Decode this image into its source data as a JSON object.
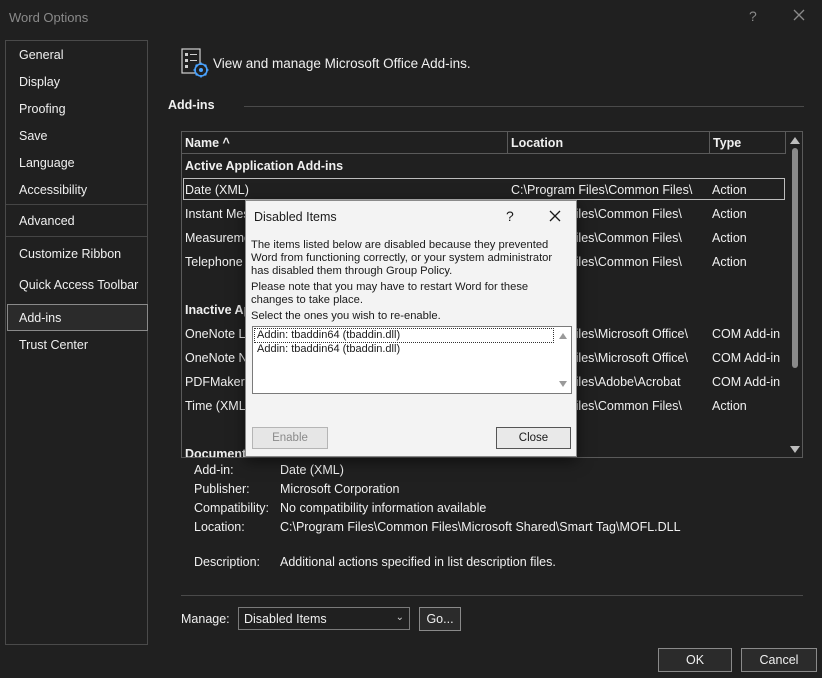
{
  "window": {
    "title": "Word Options",
    "help_glyph": "?"
  },
  "sidebar": {
    "items": [
      {
        "label": "General"
      },
      {
        "label": "Display"
      },
      {
        "label": "Proofing"
      },
      {
        "label": "Save"
      },
      {
        "label": "Language"
      },
      {
        "label": "Accessibility"
      },
      {
        "label": "Advanced"
      },
      {
        "label": "Customize Ribbon"
      },
      {
        "label": "Quick Access Toolbar"
      },
      {
        "label": "Add-ins"
      },
      {
        "label": "Trust Center"
      }
    ],
    "selected": "Add-ins"
  },
  "main": {
    "header": "View and manage Microsoft Office Add-ins.",
    "section_title": "Add-ins",
    "columns": {
      "name": "Name ^",
      "location": "Location",
      "type": "Type"
    },
    "groups": {
      "active": "Active Application Add-ins",
      "inactive": "Inactive Ap",
      "document": "Document"
    },
    "active_rows": [
      {
        "name": "Date (XML)",
        "location": "C:\\Program Files\\Common Files\\",
        "type": "Action"
      },
      {
        "name": "Instant Mes",
        "location": "Files\\Common Files\\",
        "type": "Action"
      },
      {
        "name": "Measureme",
        "location": "Files\\Common Files\\",
        "type": "Action"
      },
      {
        "name": "Telephone",
        "location": "Files\\Common Files\\",
        "type": "Action"
      }
    ],
    "inactive_rows": [
      {
        "name": "OneNote Li",
        "location": "Files\\Microsoft Office\\",
        "type": "COM Add-in"
      },
      {
        "name": "OneNote N",
        "location": "Files\\Microsoft Office\\",
        "type": "COM Add-in"
      },
      {
        "name": "PDFMaker.C",
        "location": "Files\\Adobe\\Acrobat",
        "type": "COM Add-in"
      },
      {
        "name": "Time (XML)",
        "location": "Files\\Common Files\\",
        "type": "Action"
      }
    ],
    "details": {
      "addin_label": "Add-in:",
      "addin": "Date (XML)",
      "publisher_label": "Publisher:",
      "publisher": "Microsoft Corporation",
      "compat_label": "Compatibility:",
      "compat": "No compatibility information available",
      "location_label": "Location:",
      "location": "C:\\Program Files\\Common Files\\Microsoft Shared\\Smart Tag\\MOFL.DLL",
      "description_label": "Description:",
      "description": "Additional actions specified in list description files."
    },
    "manage": {
      "label": "Manage:",
      "selected": "Disabled Items",
      "go_label": "Go..."
    }
  },
  "footer": {
    "ok_label": "OK",
    "cancel_label": "Cancel"
  },
  "modal": {
    "title": "Disabled Items",
    "help_glyph": "?",
    "text1": "The items listed below are disabled because they prevented Word from functioning correctly, or your system administrator has disabled them through Group Policy.",
    "text2": "Please note that you may have to restart Word for these changes to take place.",
    "text3": "Select the ones you wish to re-enable.",
    "items": [
      {
        "label": "Addin: tbaddin64 (tbaddin.dll)"
      },
      {
        "label": "Addin: tbaddin64 (tbaddin.dll)"
      }
    ],
    "enable_label": "Enable",
    "close_label": "Close"
  },
  "colors": {
    "background": "#202020",
    "modal_bg": "#f3f3f3",
    "text": "#f0f0f0"
  },
  "icons": {
    "header": "addin-settings-icon",
    "close": "close-icon"
  }
}
